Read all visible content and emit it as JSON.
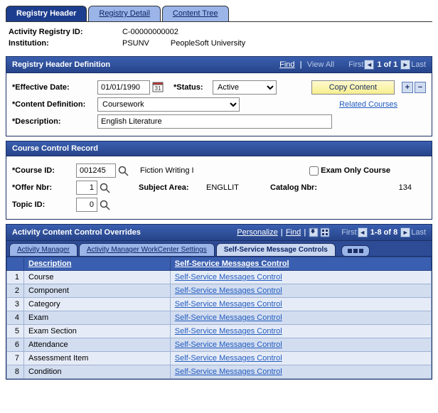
{
  "tabs": [
    {
      "label": "Registry Header",
      "active": true
    },
    {
      "label": "Registry Detail",
      "active": false
    },
    {
      "label": "Content Tree",
      "active": false
    }
  ],
  "summary": {
    "registry_id_label": "Activity Registry ID:",
    "registry_id_value": "C-00000000002",
    "institution_label": "Institution:",
    "institution_code": "PSUNV",
    "institution_name": "PeopleSoft University"
  },
  "header_section": {
    "title": "Registry Header Definition",
    "find": "Find",
    "view_all": "View All",
    "first": "First",
    "position": "1 of 1",
    "last": "Last",
    "eff_date_label": "*Effective Date:",
    "eff_date_value": "01/01/1990",
    "status_label": "*Status:",
    "status_value": "Active",
    "copy_content": "Copy Content",
    "content_def_label": "*Content Definition:",
    "content_def_value": "Coursework",
    "related_courses": "Related Courses",
    "description_label": "*Description:",
    "description_value": "English Literature"
  },
  "course_section": {
    "title": "Course Control Record",
    "course_id_label": "*Course ID:",
    "course_id_value": "001245",
    "course_name": "Fiction Writing I",
    "exam_only_label": "Exam Only Course",
    "exam_only_checked": false,
    "offer_nbr_label": "*Offer Nbr:",
    "offer_nbr_value": "1",
    "subject_area_label": "Subject Area:",
    "subject_area_value": "ENGLLIT",
    "catalog_nbr_label": "Catalog Nbr:",
    "catalog_nbr_value": "134",
    "topic_id_label": "Topic ID:",
    "topic_id_value": "0"
  },
  "overrides_section": {
    "title": "Activity Content Control Overrides",
    "personalize": "Personalize",
    "find": "Find",
    "first": "First",
    "position": "1-8 of 8",
    "last": "Last",
    "subtabs": [
      {
        "label": "Activity Manager",
        "active": false
      },
      {
        "label": "Activity Manager WorkCenter Settings",
        "active": false
      },
      {
        "label": "Self-Service Message Controls",
        "active": true
      }
    ],
    "col_description": "Description",
    "col_link": "Self-Service Messages Control",
    "rows": [
      {
        "n": "1",
        "desc": "Course",
        "link": "Self-Service Messages Control"
      },
      {
        "n": "2",
        "desc": "Component",
        "link": "Self-Service Messages Control"
      },
      {
        "n": "3",
        "desc": "Category",
        "link": "Self-Service Messages Control"
      },
      {
        "n": "4",
        "desc": "Exam",
        "link": "Self-Service Messages Control"
      },
      {
        "n": "5",
        "desc": "Exam Section",
        "link": "Self-Service Messages Control"
      },
      {
        "n": "6",
        "desc": "Attendance",
        "link": "Self-Service Messages Control"
      },
      {
        "n": "7",
        "desc": "Assessment Item",
        "link": "Self-Service Messages Control"
      },
      {
        "n": "8",
        "desc": "Condition",
        "link": "Self-Service Messages Control"
      }
    ]
  }
}
